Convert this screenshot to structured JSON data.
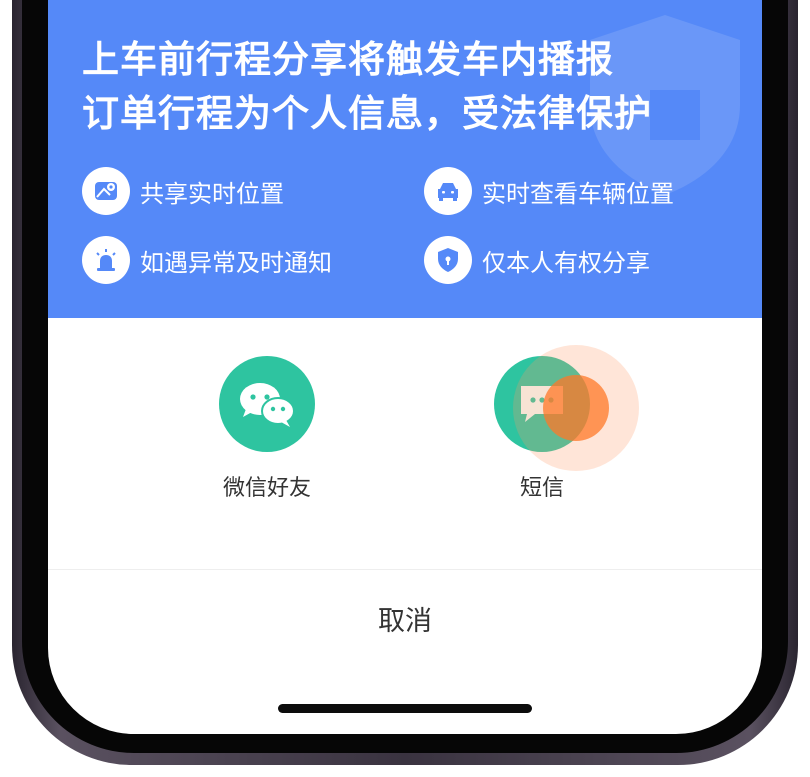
{
  "banner": {
    "headline_line1": "上车前行程分享将触发车内播报",
    "headline_line2": "订单行程为个人信息，受法律保护",
    "background_color": "#5589f8",
    "features": [
      {
        "icon": "map-location-icon",
        "label": "共享实时位置"
      },
      {
        "icon": "car-icon",
        "label": "实时查看车辆位置"
      },
      {
        "icon": "alarm-light-icon",
        "label": "如遇异常及时通知"
      },
      {
        "icon": "shield-lock-icon",
        "label": "仅本人有权分享"
      }
    ]
  },
  "share_options": [
    {
      "icon": "wechat-icon",
      "label": "微信好友"
    },
    {
      "icon": "sms-icon",
      "label": "短信"
    }
  ],
  "share_icon_color": "#2ec4a0",
  "cancel_label": "取消"
}
